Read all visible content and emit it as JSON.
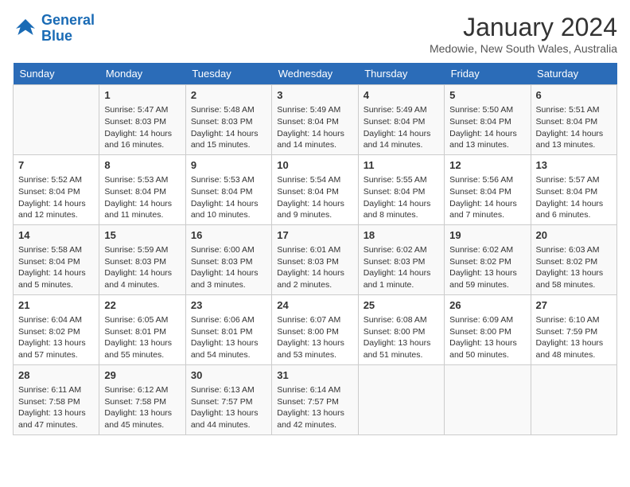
{
  "header": {
    "logo_line1": "General",
    "logo_line2": "Blue",
    "month": "January 2024",
    "location": "Medowie, New South Wales, Australia"
  },
  "days_of_week": [
    "Sunday",
    "Monday",
    "Tuesday",
    "Wednesday",
    "Thursday",
    "Friday",
    "Saturday"
  ],
  "weeks": [
    [
      {
        "day": "",
        "info": ""
      },
      {
        "day": "1",
        "info": "Sunrise: 5:47 AM\nSunset: 8:03 PM\nDaylight: 14 hours\nand 16 minutes."
      },
      {
        "day": "2",
        "info": "Sunrise: 5:48 AM\nSunset: 8:03 PM\nDaylight: 14 hours\nand 15 minutes."
      },
      {
        "day": "3",
        "info": "Sunrise: 5:49 AM\nSunset: 8:04 PM\nDaylight: 14 hours\nand 14 minutes."
      },
      {
        "day": "4",
        "info": "Sunrise: 5:49 AM\nSunset: 8:04 PM\nDaylight: 14 hours\nand 14 minutes."
      },
      {
        "day": "5",
        "info": "Sunrise: 5:50 AM\nSunset: 8:04 PM\nDaylight: 14 hours\nand 13 minutes."
      },
      {
        "day": "6",
        "info": "Sunrise: 5:51 AM\nSunset: 8:04 PM\nDaylight: 14 hours\nand 13 minutes."
      }
    ],
    [
      {
        "day": "7",
        "info": "Sunrise: 5:52 AM\nSunset: 8:04 PM\nDaylight: 14 hours\nand 12 minutes."
      },
      {
        "day": "8",
        "info": "Sunrise: 5:53 AM\nSunset: 8:04 PM\nDaylight: 14 hours\nand 11 minutes."
      },
      {
        "day": "9",
        "info": "Sunrise: 5:53 AM\nSunset: 8:04 PM\nDaylight: 14 hours\nand 10 minutes."
      },
      {
        "day": "10",
        "info": "Sunrise: 5:54 AM\nSunset: 8:04 PM\nDaylight: 14 hours\nand 9 minutes."
      },
      {
        "day": "11",
        "info": "Sunrise: 5:55 AM\nSunset: 8:04 PM\nDaylight: 14 hours\nand 8 minutes."
      },
      {
        "day": "12",
        "info": "Sunrise: 5:56 AM\nSunset: 8:04 PM\nDaylight: 14 hours\nand 7 minutes."
      },
      {
        "day": "13",
        "info": "Sunrise: 5:57 AM\nSunset: 8:04 PM\nDaylight: 14 hours\nand 6 minutes."
      }
    ],
    [
      {
        "day": "14",
        "info": "Sunrise: 5:58 AM\nSunset: 8:04 PM\nDaylight: 14 hours\nand 5 minutes."
      },
      {
        "day": "15",
        "info": "Sunrise: 5:59 AM\nSunset: 8:03 PM\nDaylight: 14 hours\nand 4 minutes."
      },
      {
        "day": "16",
        "info": "Sunrise: 6:00 AM\nSunset: 8:03 PM\nDaylight: 14 hours\nand 3 minutes."
      },
      {
        "day": "17",
        "info": "Sunrise: 6:01 AM\nSunset: 8:03 PM\nDaylight: 14 hours\nand 2 minutes."
      },
      {
        "day": "18",
        "info": "Sunrise: 6:02 AM\nSunset: 8:03 PM\nDaylight: 14 hours\nand 1 minute."
      },
      {
        "day": "19",
        "info": "Sunrise: 6:02 AM\nSunset: 8:02 PM\nDaylight: 13 hours\nand 59 minutes."
      },
      {
        "day": "20",
        "info": "Sunrise: 6:03 AM\nSunset: 8:02 PM\nDaylight: 13 hours\nand 58 minutes."
      }
    ],
    [
      {
        "day": "21",
        "info": "Sunrise: 6:04 AM\nSunset: 8:02 PM\nDaylight: 13 hours\nand 57 minutes."
      },
      {
        "day": "22",
        "info": "Sunrise: 6:05 AM\nSunset: 8:01 PM\nDaylight: 13 hours\nand 55 minutes."
      },
      {
        "day": "23",
        "info": "Sunrise: 6:06 AM\nSunset: 8:01 PM\nDaylight: 13 hours\nand 54 minutes."
      },
      {
        "day": "24",
        "info": "Sunrise: 6:07 AM\nSunset: 8:00 PM\nDaylight: 13 hours\nand 53 minutes."
      },
      {
        "day": "25",
        "info": "Sunrise: 6:08 AM\nSunset: 8:00 PM\nDaylight: 13 hours\nand 51 minutes."
      },
      {
        "day": "26",
        "info": "Sunrise: 6:09 AM\nSunset: 8:00 PM\nDaylight: 13 hours\nand 50 minutes."
      },
      {
        "day": "27",
        "info": "Sunrise: 6:10 AM\nSunset: 7:59 PM\nDaylight: 13 hours\nand 48 minutes."
      }
    ],
    [
      {
        "day": "28",
        "info": "Sunrise: 6:11 AM\nSunset: 7:58 PM\nDaylight: 13 hours\nand 47 minutes."
      },
      {
        "day": "29",
        "info": "Sunrise: 6:12 AM\nSunset: 7:58 PM\nDaylight: 13 hours\nand 45 minutes."
      },
      {
        "day": "30",
        "info": "Sunrise: 6:13 AM\nSunset: 7:57 PM\nDaylight: 13 hours\nand 44 minutes."
      },
      {
        "day": "31",
        "info": "Sunrise: 6:14 AM\nSunset: 7:57 PM\nDaylight: 13 hours\nand 42 minutes."
      },
      {
        "day": "",
        "info": ""
      },
      {
        "day": "",
        "info": ""
      },
      {
        "day": "",
        "info": ""
      }
    ]
  ]
}
